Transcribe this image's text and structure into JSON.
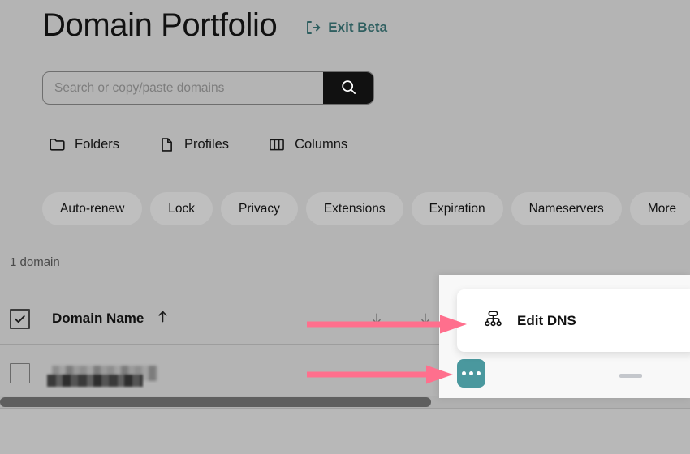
{
  "header": {
    "title": "Domain Portfolio",
    "exit_beta_label": "Exit Beta",
    "exit_beta_color": "#2f5f60"
  },
  "search": {
    "placeholder": "Search or copy/paste domains",
    "value": "",
    "button_icon": "search-icon"
  },
  "toolbar": {
    "items": [
      {
        "label": "Folders",
        "icon": "folder-icon"
      },
      {
        "label": "Profiles",
        "icon": "document-icon"
      },
      {
        "label": "Columns",
        "icon": "columns-icon"
      }
    ]
  },
  "filters": {
    "chips": [
      {
        "label": "Auto-renew"
      },
      {
        "label": "Lock"
      },
      {
        "label": "Privacy"
      },
      {
        "label": "Extensions"
      },
      {
        "label": "Expiration"
      },
      {
        "label": "Nameservers"
      },
      {
        "label": "More"
      }
    ]
  },
  "table": {
    "count_label": "1 domain",
    "header": {
      "select_all_checked": true,
      "domain_column_label": "Domain Name",
      "domain_sort_direction": "ascending",
      "sort_icon": "arrow-up-icon",
      "other_column_icons": [
        "arrow-down-icon",
        "arrow-down-icon"
      ]
    },
    "rows": [
      {
        "selected": false,
        "domain_name_redacted": true,
        "kebab_label": "•••",
        "value_placeholder": "—"
      }
    ]
  },
  "context_menu": {
    "items": [
      {
        "label": "Edit DNS",
        "icon": "sitemap-icon"
      }
    ]
  },
  "actions": {
    "kebab_color": "#4a989e",
    "kebab_icon": "ellipsis-icon"
  },
  "annotations": {
    "color": "#ff6f8d",
    "arrows": [
      {
        "target": "column-header-area",
        "direction": "right"
      },
      {
        "target": "row-kebab-button",
        "direction": "right"
      }
    ]
  },
  "scrollbar": {
    "orientation": "horizontal",
    "thumb_position_percent": 0
  }
}
